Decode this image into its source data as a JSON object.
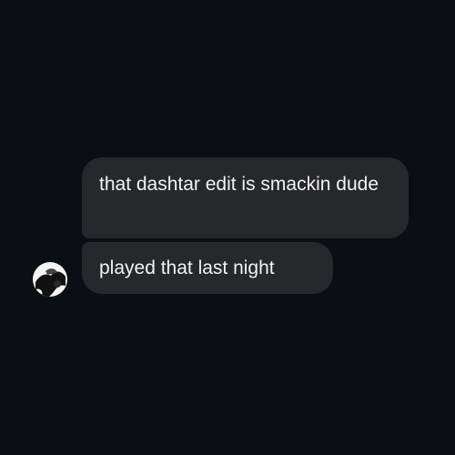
{
  "conversation": {
    "messages": [
      {
        "text": "that dashtar edit is smackin dude",
        "sender": "other"
      },
      {
        "text": "played that last night",
        "sender": "other"
      }
    ],
    "sender_avatar": "profile-photo-avatar"
  },
  "colors": {
    "background": "#0b0e13",
    "bubble": "#26282c",
    "text": "#f2f2f2"
  }
}
